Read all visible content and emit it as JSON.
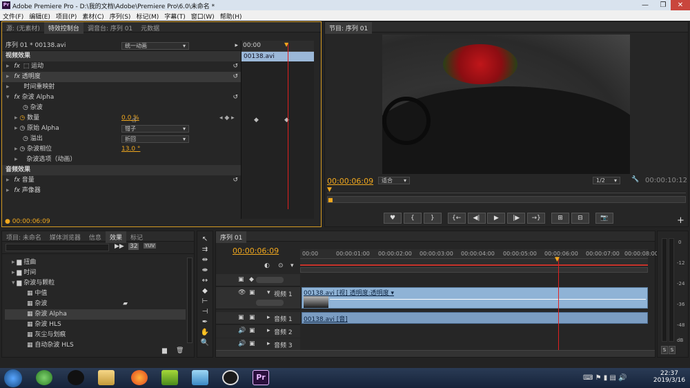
{
  "window": {
    "title": "Adobe Premiere Pro - D:\\我的文档\\Adobe\\Premiere Pro\\6.0\\未命名 *",
    "app_badge": "Pr",
    "min": "—",
    "max": "❐",
    "close": "✕"
  },
  "menu": [
    "文件(F)",
    "编辑(E)",
    "项目(P)",
    "素材(C)",
    "序列(S)",
    "标记(M)",
    "字幕(T)",
    "窗口(W)",
    "帮助(H)"
  ],
  "effect_controls": {
    "tabs": [
      "源: (无素材)",
      "特效控制台",
      "调音台: 序列 01",
      "元数据"
    ],
    "clip_header": "序列 01 * 00138.avi",
    "mini_time": "00:00",
    "mini_clip": "00138.avi",
    "video_effects": "视频效果",
    "motion": "运动",
    "opacity": "透明度",
    "time_remap": "时间重映射",
    "noise_alpha": "杂波 Alpha",
    "noise_label": "杂波",
    "noise_value": "统一动画",
    "amount_label": "数量",
    "amount_value": "0.0 %",
    "original_alpha_label": "原始 Alpha",
    "original_alpha_value": "钳子",
    "overflow_label": "溢出",
    "overflow_value": "折回",
    "noise_phase_label": "杂波相位",
    "noise_phase_value": "13.0 °",
    "noise_options": "杂波选项（动画）",
    "audio_effects": "音频效果",
    "volume": "音量",
    "panner": "声像器",
    "timecode": "00:00:06:09"
  },
  "program": {
    "tab": "节目: 序列 01",
    "timecode": "00:00:06:09",
    "fit": "适合",
    "resolution": "1/2",
    "duration": "00:00:10:12",
    "buttons": [
      "♥",
      "{",
      "}",
      "{←",
      "◀|",
      "▶",
      "|▶",
      "→}",
      "⊞",
      "⊟",
      "📷"
    ],
    "add": "+"
  },
  "project": {
    "tabs": [
      "项目: 未命名",
      "媒体浏览器",
      "信息",
      "效果",
      "标记"
    ],
    "toolbar": [
      "32",
      "YUV"
    ],
    "items": [
      {
        "label": "扭曲",
        "type": "folder"
      },
      {
        "label": "时间",
        "type": "folder"
      },
      {
        "label": "杂波与颗粒",
        "type": "folder-open"
      },
      {
        "label": "中值",
        "type": "fx"
      },
      {
        "label": "杂波",
        "type": "fx"
      },
      {
        "label": "杂波 Alpha",
        "type": "fx"
      },
      {
        "label": "杂波 HLS",
        "type": "fx"
      },
      {
        "label": "灰尘与划痕",
        "type": "fx"
      },
      {
        "label": "自动杂波 HLS",
        "type": "fx"
      }
    ]
  },
  "timeline": {
    "tab": "序列 01",
    "timecode": "00:00:06:09",
    "ticks": [
      "00:00",
      "00:00:01:00",
      "00:00:02:00",
      "00:00:03:00",
      "00:00:04:00",
      "00:00:05:00",
      "00:00:06:00",
      "00:00:07:00",
      "00:00:08:00"
    ],
    "video_track": "视频 1",
    "video_clip": "00138.avi [视] 透明度:透明度 ▾",
    "audio_tracks": [
      "音频 1",
      "音频 2",
      "音频 3"
    ],
    "audio_clip": "00138.avi [音]"
  },
  "meters": {
    "labels": [
      "0",
      "-12",
      "-24",
      "-36",
      "-48",
      "dB"
    ],
    "solo": [
      "S",
      "S"
    ]
  },
  "taskbar": {
    "time": "22:37",
    "date": "2019/3/16"
  }
}
